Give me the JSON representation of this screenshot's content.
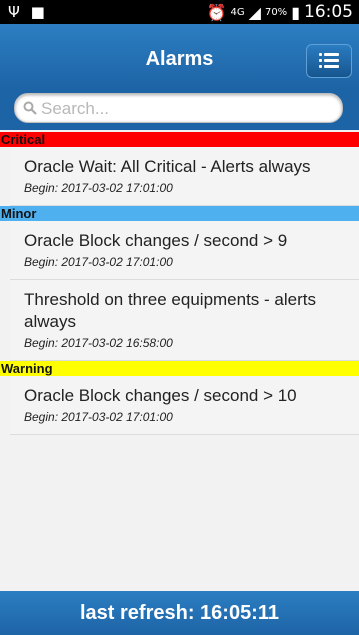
{
  "status_bar": {
    "battery": "70%",
    "network": "4G",
    "time": "16:05"
  },
  "header": {
    "title": "Alarms"
  },
  "search": {
    "placeholder": "Search..."
  },
  "groups": [
    {
      "label": "Critical",
      "color": "#ff0000",
      "items": [
        {
          "name": "Oracle Wait: All Critical - Alerts always",
          "begin": "Begin: 2017-03-02 17:01:00"
        }
      ]
    },
    {
      "label": "Minor",
      "color": "#4fb0f0",
      "items": [
        {
          "name": "Oracle Block changes / second > 9",
          "begin": "Begin: 2017-03-02 17:01:00"
        },
        {
          "name": "Threshold on three equipments - alerts always",
          "begin": "Begin: 2017-03-02 16:58:00"
        }
      ]
    },
    {
      "label": "Warning",
      "color": "#ffff00",
      "items": [
        {
          "name": "Oracle Block changes / second > 10",
          "begin": "Begin: 2017-03-02 17:01:00"
        }
      ]
    }
  ],
  "footer": {
    "text": "last refresh: 16:05:11"
  },
  "icons": [
    "usb-icon",
    "image-icon",
    "alarm-clock-icon",
    "signal-icon",
    "battery-icon",
    "menu-icon",
    "search-icon"
  ]
}
